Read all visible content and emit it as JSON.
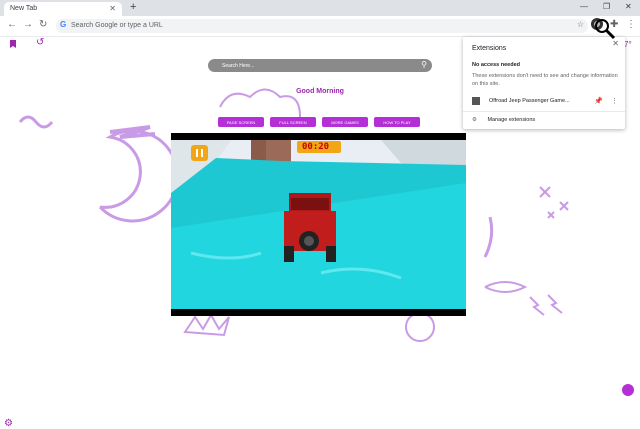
{
  "tab": {
    "title": "New Tab"
  },
  "omnibox": {
    "placeholder": "Search Google or type a URL"
  },
  "page": {
    "search_placeholder": "Search Here...",
    "greeting": "Good Morning",
    "buttons": [
      "PAGE SCREEN",
      "FULL SCREEN",
      "MORE GAMES",
      "HOW TO PLAY"
    ],
    "timer": "00:20",
    "weather_fragment": "7°"
  },
  "extensions_popup": {
    "title": "Extensions",
    "no_access_heading": "No access needed",
    "no_access_desc": "These extensions don't need to see and change information on this site.",
    "extension_name": "Offroad Jeep Passenger Game...",
    "manage": "Manage extensions"
  },
  "colors": {
    "accent": "#9c27b0",
    "button": "#b42fd6",
    "water": "#21d6df",
    "sky": "#e8eef4"
  }
}
